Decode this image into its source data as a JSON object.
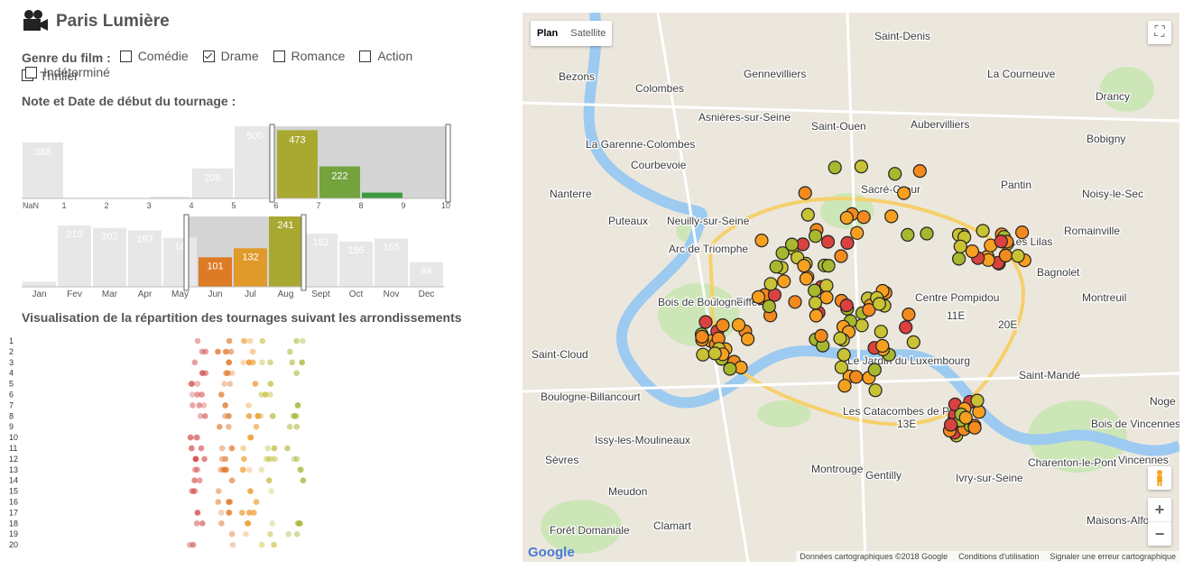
{
  "app": {
    "title": "Paris Lumière"
  },
  "genre": {
    "label": "Genre du film :",
    "options": [
      {
        "label": "Comédie",
        "checked": false
      },
      {
        "label": "Drame",
        "checked": true
      },
      {
        "label": "Romance",
        "checked": false
      },
      {
        "label": "Action",
        "checked": false
      },
      {
        "label": "Thriller",
        "checked": false
      },
      {
        "label": "Indéterminé",
        "checked": false
      }
    ]
  },
  "sections": {
    "rating_date": "Note et Date de début du tournage :",
    "arrondissements": "Visualisation de la répartition des tournages suivant les arrondissements"
  },
  "chart_data": [
    {
      "type": "bar",
      "categories": [
        "NaN",
        "1",
        "2",
        "3",
        "4",
        "5",
        "6",
        "7",
        "8",
        "9",
        "10"
      ],
      "values": [
        388,
        0,
        2,
        12,
        208,
        500,
        473,
        222,
        40,
        0
      ],
      "labels": [
        "388",
        "",
        "",
        "",
        "208",
        "500",
        "473",
        "222",
        "",
        ""
      ],
      "brush": [
        5.9,
        9.9
      ]
    },
    {
      "type": "bar",
      "categories": [
        "Jan",
        "Fev",
        "Mar",
        "Apr",
        "May",
        "Jun",
        "Jul",
        "Aug",
        "Sept",
        "Oct",
        "Nov",
        "Dec"
      ],
      "values": [
        17,
        210,
        202,
        193,
        168,
        101,
        132,
        241,
        182,
        155,
        165,
        84
      ],
      "labels": [
        "17",
        "210",
        "202",
        "193",
        "16",
        "101",
        "132",
        "241",
        "182",
        "155",
        "165",
        "84"
      ],
      "brush": [
        "May",
        "Aug"
      ]
    },
    {
      "type": "scatter",
      "ylabels": [
        "1",
        "2",
        "3",
        "4",
        "5",
        "6",
        "7",
        "8",
        "9",
        "10",
        "11",
        "12",
        "13",
        "14",
        "15",
        "16",
        "17",
        "18",
        "19",
        "20"
      ]
    }
  ],
  "map": {
    "btn_plan": "Plan",
    "btn_sat": "Satellite",
    "zoom_in": "+",
    "zoom_out": "−",
    "logo": "Google",
    "attrib": [
      "Données cartographiques ©2018 Google",
      "Conditions d'utilisation",
      "Signaler une erreur cartographique"
    ],
    "places": [
      "Saint-Denis",
      "Colombes",
      "Asnières-sur-Seine",
      "Gennevilliers",
      "Saint-Ouen",
      "Aubervilliers",
      "Bobigny",
      "La Garenne-Colombes",
      "Courbevoie",
      "Nanterre",
      "Puteaux",
      "Neuilly-sur-Seine",
      "Pantin",
      "Noisy-le-Sec",
      "Romainville",
      "Les Lilas",
      "Bagnolet",
      "Montreuil",
      "20E",
      "11E",
      "Arc de Triomphe",
      "Tour Eiffel",
      "Bois de Boulogne",
      "Saint-Cloud",
      "Boulogne-Billancourt",
      "Les Catacombes de Paris",
      "13E",
      "Issy-les-Moulineaux",
      "Montrouge",
      "Gentilly",
      "Ivry-sur-Seine",
      "Saint-Mandé",
      "Bois de Vincennes",
      "Charenton-le-Pont",
      "Meudon",
      "Sèvres",
      "Clamart",
      "Maisons-Alfort",
      "Forêt Domaniale",
      "Drancy",
      "La Courneuve",
      "Bezons",
      "Centre Pompidou",
      "Sacré-Cœur",
      "Le Jardin du Luxembourg",
      "Vincennes",
      "Noge"
    ]
  }
}
